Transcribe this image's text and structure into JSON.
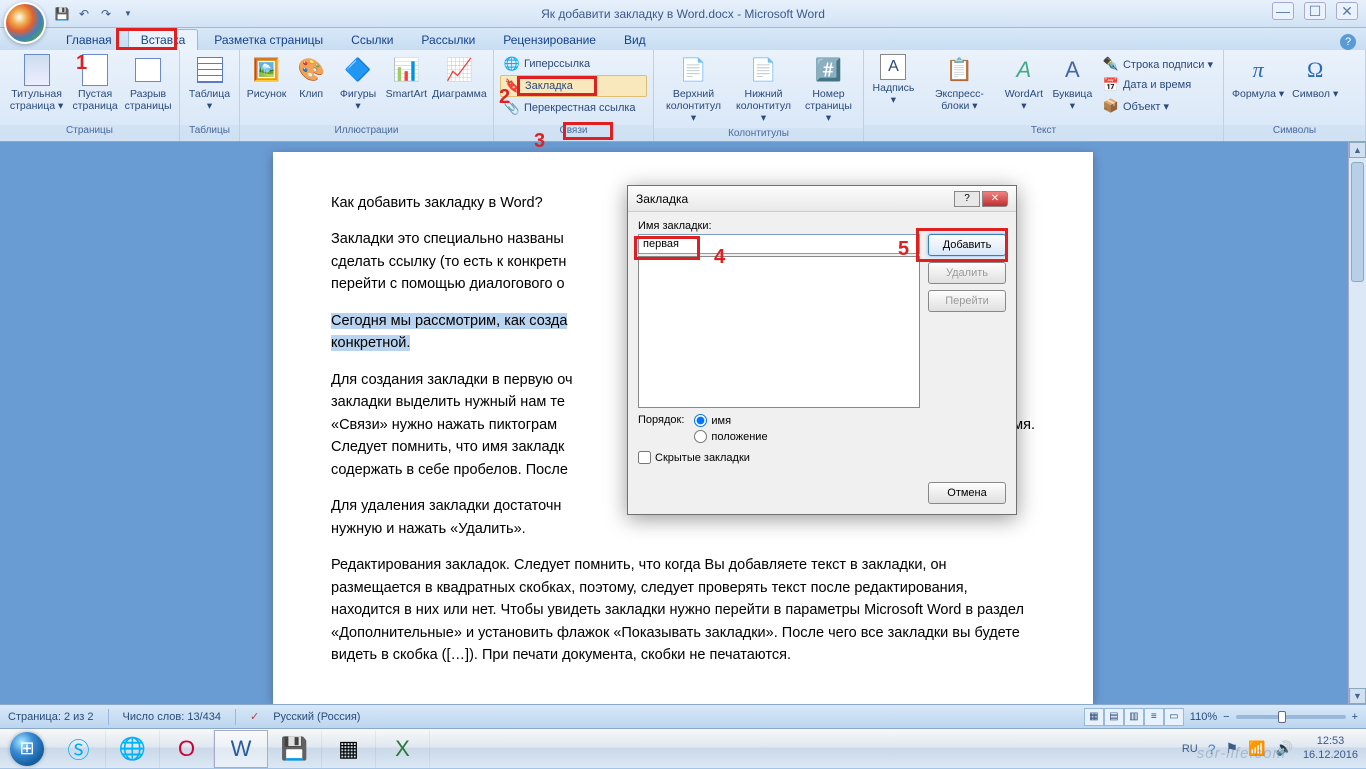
{
  "title": "Як добавити закладку в Word.docx - Microsoft Word",
  "tabs": [
    "Главная",
    "Вставка",
    "Разметка страницы",
    "Ссылки",
    "Рассылки",
    "Рецензирование",
    "Вид"
  ],
  "active_tab": 1,
  "ribbon": {
    "pages": {
      "label": "Страницы",
      "btns": [
        "Титульная страница ▾",
        "Пустая страница",
        "Разрыв страницы"
      ]
    },
    "tables": {
      "label": "Таблицы",
      "btn": "Таблица ▾"
    },
    "illus": {
      "label": "Иллюстрации",
      "btns": [
        "Рисунок",
        "Клип",
        "Фигуры ▾",
        "SmartArt",
        "Диаграмма"
      ]
    },
    "links": {
      "label": "Связи",
      "items": [
        "Гиперссылка",
        "Закладка",
        "Перекрестная ссылка"
      ]
    },
    "headfoot": {
      "label": "Колонтитулы",
      "btns": [
        "Верхний колонтитул ▾",
        "Нижний колонтитул ▾",
        "Номер страницы ▾"
      ]
    },
    "text": {
      "label": "Текст",
      "btns": [
        "Надпись ▾",
        "Экспресс-блоки ▾",
        "WordArt ▾",
        "Буквица ▾"
      ],
      "items": [
        "Строка подписи ▾",
        "Дата и время",
        "Объект ▾"
      ]
    },
    "symbols": {
      "label": "Символы",
      "btns": [
        "Формула ▾",
        "Символ ▾"
      ]
    }
  },
  "doc": {
    "p1": "Как добавить закладку в Word?",
    "p2": "Закладки это специально названы",
    "p2b": "сделать ссылку (то есть к конкретн",
    "p2c": "перейти с помощью диалогового о",
    "p3a": "Сегодня мы рассмотрим, как созда",
    "p3b": "конкретной.",
    "p4a": "Для создания закладки в первую оч",
    "p4b": "закладки выделить нужный нам те",
    "p4c": "«Связи» нужно нажать пиктограм",
    "p4cR": "мя.",
    "p4d": "Следует помнить, что имя закладк",
    "p4e": "содержать в себе пробелов. После",
    "p5a": "Для удаления закладки достаточн",
    "p5b": "нужную и нажать «Удалить».",
    "p6": "Редактирования закладок. Следует помнить, что когда Вы добавляете текст в закладки, он размещается в квадратных скобках, поэтому, следует проверять текст после редактирования,  находится в них или нет. Чтобы увидеть закладки нужно перейти в параметры Microsoft Word в раздел «Дополнительные» и установить флажок «Показывать закладки». После чего все закладки вы будете видеть в скобка ([…]). При печати документа, скобки не печатаются."
  },
  "dialog": {
    "title": "Закладка",
    "name_label": "Имя закладки:",
    "name_value": "первая",
    "add": "Добавить",
    "delete": "Удалить",
    "goto": "Перейти",
    "sort_label": "Порядок:",
    "sort_name": "имя",
    "sort_pos": "положение",
    "hidden": "Скрытые закладки",
    "cancel": "Отмена"
  },
  "callouts": {
    "n1": "1",
    "n2": "2",
    "n3": "3",
    "n4": "4",
    "n5": "5"
  },
  "status": {
    "page": "Страница: 2 из 2",
    "words": "Число слов: 13/434",
    "lang": "Русский (Россия)",
    "zoom": "110%"
  },
  "tray": {
    "lang": "RU",
    "time": "12:53",
    "date": "16.12.2016"
  },
  "watermark": "sor-life.com"
}
